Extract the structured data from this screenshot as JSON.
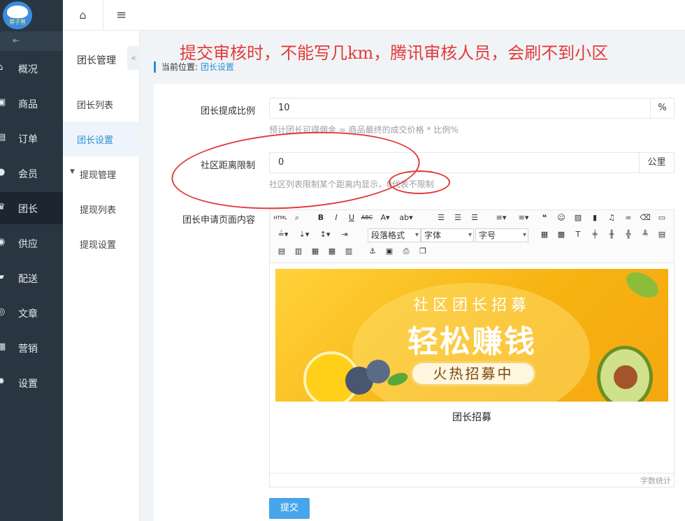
{
  "logo": {
    "text": "第子兽"
  },
  "sidebar": {
    "collapse_icon": "collapse-icon",
    "items": [
      {
        "label": "概况",
        "icon": "home-icon"
      },
      {
        "label": "商品",
        "icon": "box-icon"
      },
      {
        "label": "订单",
        "icon": "order-icon"
      },
      {
        "label": "会员",
        "icon": "users-icon"
      },
      {
        "label": "团长",
        "icon": "crown-icon",
        "active": true
      },
      {
        "label": "供应",
        "icon": "supply-icon"
      },
      {
        "label": "配送",
        "icon": "truck-icon"
      },
      {
        "label": "文章",
        "icon": "compass-icon"
      },
      {
        "label": "营销",
        "icon": "gift-icon"
      },
      {
        "label": "设置",
        "icon": "gear-icon"
      }
    ]
  },
  "subnav": {
    "title": "团长管理",
    "collapse_glyph": "«",
    "items": [
      {
        "label": "团长列表"
      },
      {
        "label": "团长设置",
        "active": true
      },
      {
        "label": "提现管理",
        "expandable": true
      },
      {
        "label": "提现列表"
      },
      {
        "label": "提现设置"
      }
    ]
  },
  "topbar": {
    "home_icon": "home-icon",
    "menu_icon": "menu-icon"
  },
  "annotation": "提交审核时，不能写几km，腾讯审核人员，会刷不到小区",
  "breadcrumb": {
    "prefix": "当前位置:",
    "current": "团长设置"
  },
  "form": {
    "commission": {
      "label": "团长提成比例",
      "value": "10",
      "unit": "%",
      "help": "预计团长可得佣金 = 商品最终的成交价格 * 比例%"
    },
    "distance": {
      "label": "社区距离限制",
      "value": "0",
      "unit": "公里",
      "help": "社区列表限制某个距离内显示，0代表不限制"
    },
    "content": {
      "label": "团长申请页面内容"
    }
  },
  "editor": {
    "toolbar": {
      "html_label": "HTML",
      "paragraph": "段落格式",
      "font": "字体",
      "size": "字号"
    },
    "banner": {
      "line1": "社区团长招募",
      "line2": "轻松赚钱",
      "pill": "火热招募中"
    },
    "caption": "团长招募",
    "word_count": "字数统计"
  },
  "submit_label": "提交",
  "colors": {
    "accent": "#2c8fd6",
    "annotation": "#e23a3a",
    "sidebar": "#2a3542"
  }
}
